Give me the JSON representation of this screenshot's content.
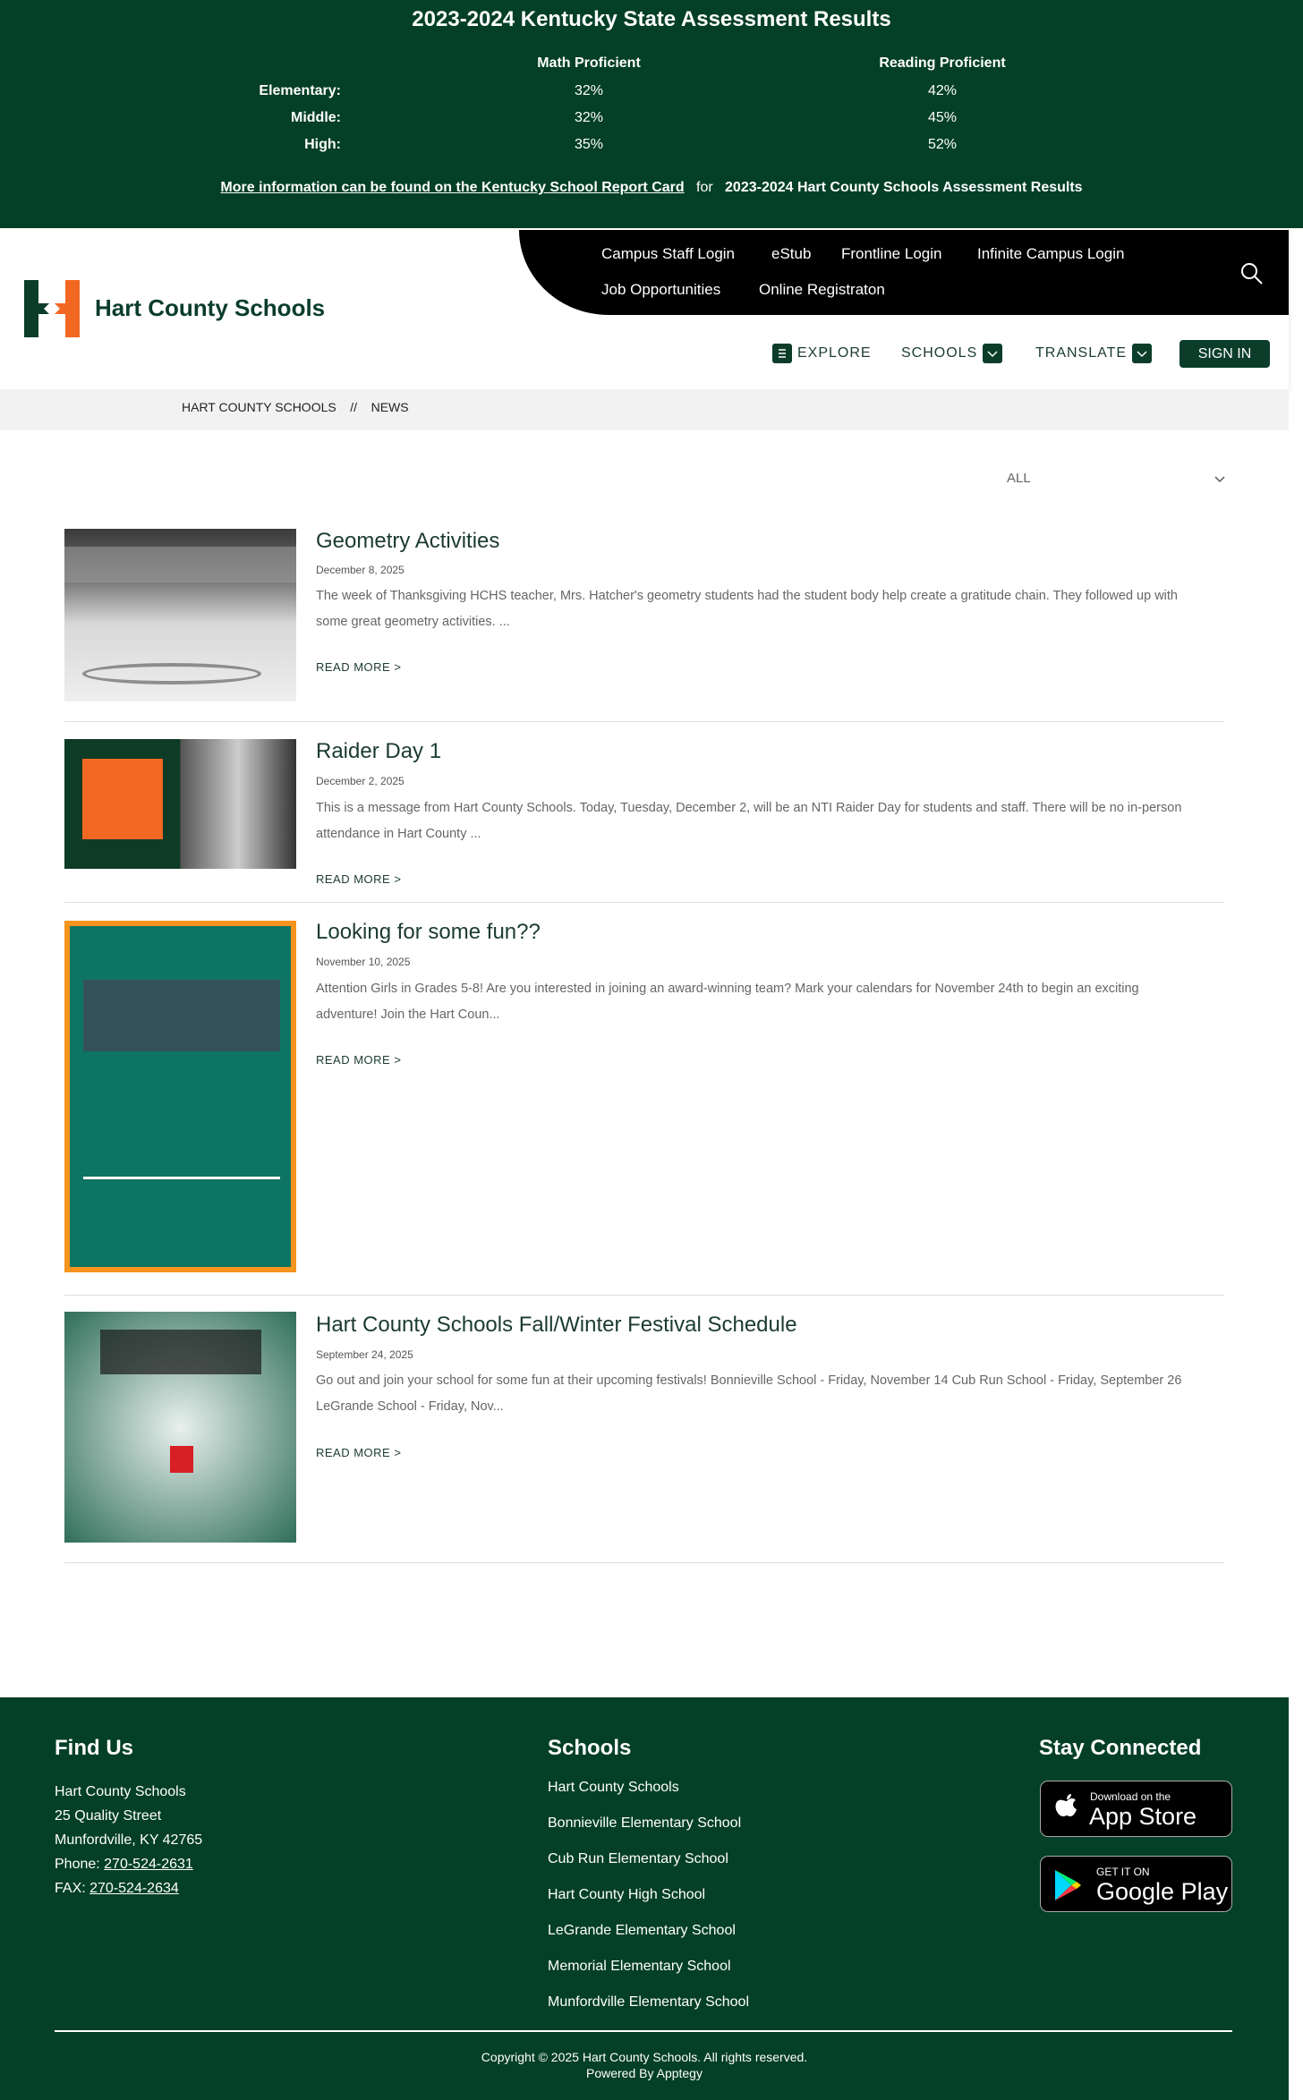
{
  "banner": {
    "title": "2023-2024 Kentucky State Assessment Results",
    "headers": [
      "Math Proficient",
      "Reading Proficient"
    ],
    "rows": [
      {
        "label": "Elementary:",
        "math": "32%",
        "reading": "42%"
      },
      {
        "label": "Middle:",
        "math": "32%",
        "reading": "45%"
      },
      {
        "label": "High:",
        "math": "35%",
        "reading": "52%"
      }
    ],
    "link": "More information can be found on the Kentucky School Report Card",
    "for": "for",
    "suffix": "2023-2024 Hart County Schools Assessment Results"
  },
  "header": {
    "site_name": "Hart County Schools",
    "top_links": [
      "Campus Staff Login",
      "eStub",
      "Frontline Login",
      "Infinite Campus Login",
      "Job Opportunities",
      "Online Registraton"
    ],
    "explore": "EXPLORE",
    "schools": "SCHOOLS",
    "translate": "TRANSLATE",
    "sign_in": "SIGN IN"
  },
  "breadcrumb": {
    "home": "HART COUNTY SCHOOLS",
    "sep": "//",
    "current": "NEWS"
  },
  "filter": {
    "value": "ALL"
  },
  "articles": [
    {
      "title": "Geometry Activities",
      "date": "December 8, 2025",
      "desc": "The week of Thanksgiving HCHS teacher, Mrs. Hatcher's geometry students had the student body help create a gratitude chain. They followed up with some great geometry activities. ...",
      "more": "READ MORE >"
    },
    {
      "title": "Raider Day 1",
      "date": "December 2, 2025",
      "desc": "This is a message from Hart County Schools. Today, Tuesday, December 2, will be an NTI Raider Day for students and staff. There will be no in-person attendance in Hart County ...",
      "more": "READ MORE >"
    },
    {
      "title": "Looking for some fun??",
      "date": "November 10, 2025",
      "desc": "Attention Girls in Grades 5-8! Are you interested in joining an award-winning team? Mark your calendars for November 24th to begin an exciting adventure! Join the Hart Coun...",
      "more": "READ MORE >"
    },
    {
      "title": "Hart County Schools Fall/Winter Festival Schedule",
      "date": "September 24, 2025",
      "desc": "Go out and join your school for some fun at their upcoming festivals! Bonnieville School - Friday, November 14 Cub Run School - Friday, September 26 LeGrande School - Friday, Nov...",
      "more": "READ MORE >"
    }
  ],
  "footer": {
    "find_us": "Find Us",
    "address": [
      "Hart County Schools",
      "25 Quality Street",
      "Munfordville, KY 42765"
    ],
    "phone_label": "Phone: ",
    "phone": "270-524-2631",
    "fax_label": "FAX: ",
    "fax": "270-524-2634",
    "schools_heading": "Schools",
    "schools": [
      "Hart County Schools",
      "Bonnieville Elementary School",
      "Cub Run Elementary School",
      "Hart County High School",
      "LeGrande Elementary School",
      "Memorial Elementary School",
      "Munfordville Elementary School"
    ],
    "stay": "Stay Connected",
    "appstore_small": "Download on the",
    "appstore_big": "App Store",
    "play_small": "GET IT ON",
    "play_big": "Google Play",
    "copyright": "Copyright © 2025 Hart County Schools. All rights reserved.",
    "powered": "Powered By Apptegy"
  },
  "colors": {
    "brand_green": "#043f28",
    "accent_orange": "#f26722"
  }
}
